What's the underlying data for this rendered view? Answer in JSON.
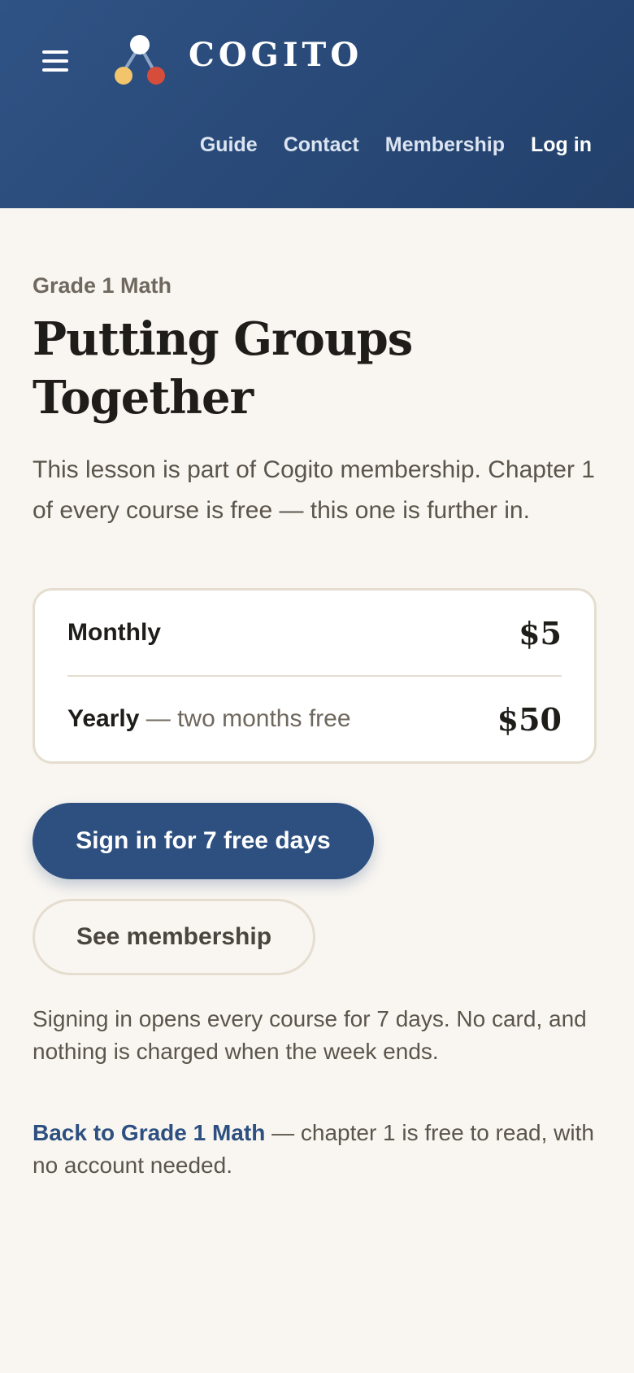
{
  "header": {
    "menu_icon": "hamburger-menu-icon",
    "logo_icon": "cogito-logo-icon",
    "brand": "COGITO",
    "nav": {
      "guide": "Guide",
      "contact": "Contact",
      "membership": "Membership",
      "login": "Log in"
    },
    "colors": {
      "background": "#2f5385",
      "logo_top": "#ffffff",
      "logo_left": "#f2c46b",
      "logo_right": "#d64d3c"
    }
  },
  "lesson": {
    "breadcrumb": "Grade 1 Math",
    "title": "Putting Groups Together",
    "description": "This lesson is part of Cogito membership. Chapter 1 of every course is free — this one is further in."
  },
  "pricing": {
    "monthly": {
      "label": "Monthly",
      "price": "$5"
    },
    "yearly": {
      "label": "Yearly",
      "note": " — two months free",
      "price": "$50"
    }
  },
  "actions": {
    "primary": "Sign in for 7 free days",
    "secondary": "See membership"
  },
  "trial_note": "Signing in opens every course for 7 days. No card, and nothing is charged when the week ends.",
  "back": {
    "link": "Back to Grade 1 Math",
    "text": " — chapter 1 is free to read, with no account needed."
  },
  "theme": {
    "accent": "#2d5081",
    "page_background": "#f9f6f1"
  }
}
